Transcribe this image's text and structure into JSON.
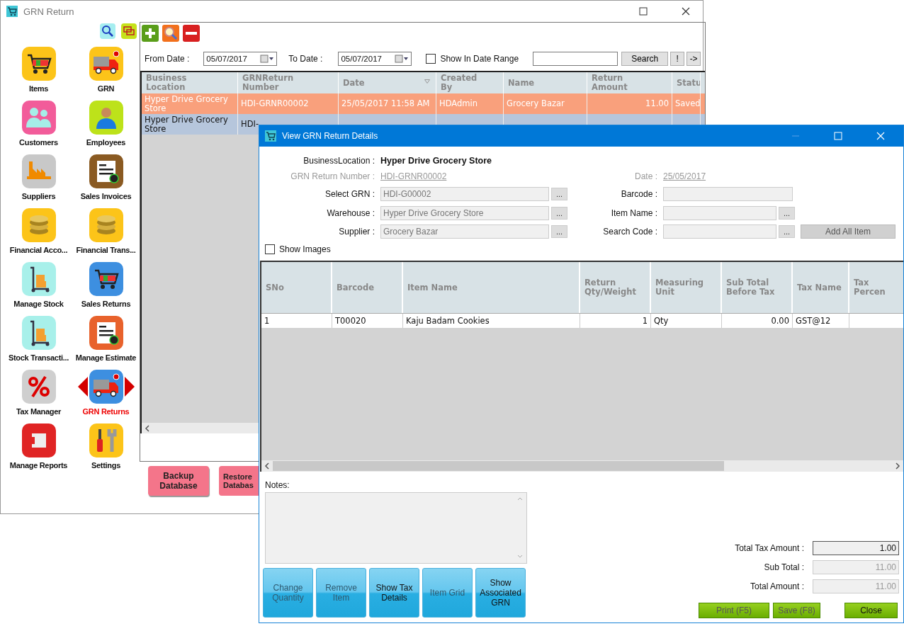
{
  "main_window": {
    "title": "GRN Return"
  },
  "sidebar": {
    "items": [
      {
        "label": "Items",
        "color": "#fcc419",
        "selected": false
      },
      {
        "label": "GRN",
        "color": "#fcc419",
        "selected": false
      },
      {
        "label": "Customers",
        "color": "#f25c9a",
        "selected": false
      },
      {
        "label": "Employees",
        "color": "#bde21a",
        "selected": false
      },
      {
        "label": "Suppliers",
        "color": "#c8c8c8",
        "selected": false
      },
      {
        "label": "Sales Invoices",
        "color": "#8a5a22",
        "selected": false
      },
      {
        "label": "Financial Acco...",
        "color": "#fcc419",
        "selected": false
      },
      {
        "label": "Financial Trans...",
        "color": "#fcc419",
        "selected": false
      },
      {
        "label": "Manage Stock",
        "color": "#a8f0ea",
        "selected": false
      },
      {
        "label": "Sales Returns",
        "color": "#3d8fe0",
        "selected": false
      },
      {
        "label": "Stock Transacti...",
        "color": "#a8f0ea",
        "selected": false
      },
      {
        "label": "Manage Estimate",
        "color": "#e8622c",
        "selected": false
      },
      {
        "label": "Tax Manager",
        "color": "#cfcfcf",
        "selected": false
      },
      {
        "label": "GRN Returns",
        "color": "#3d8fe0",
        "selected": true
      },
      {
        "label": "Manage Reports",
        "color": "#e02424",
        "selected": false
      },
      {
        "label": "Settings",
        "color": "#fcc419",
        "selected": false
      }
    ]
  },
  "filter": {
    "from_label": "From Date :",
    "from_date": "05/07/2017",
    "to_label": "To Date :",
    "to_date": "05/07/2017",
    "date_range": {
      "label": "Show In Date Range",
      "checked": false
    },
    "search_button": "Search",
    "button_2": "!",
    "button_3": "->"
  },
  "grn_table": {
    "columns": [
      {
        "label": "Business Location",
        "sorted": false
      },
      {
        "label": "GRNReturn Number",
        "sorted": false
      },
      {
        "label": "Date",
        "sorted": true
      },
      {
        "label": "Created By",
        "sorted": false
      },
      {
        "label": "Name",
        "sorted": false
      },
      {
        "label": "Return Amount",
        "sorted": false
      },
      {
        "label": "Statu",
        "sorted": false
      }
    ],
    "rows": [
      {
        "selected": true,
        "business_location": "Hyper Drive Grocery Store",
        "grn_return_number": "HDI-GRNR00002",
        "date": "25/05/2017 11:58 AM",
        "created_by": "HDAdmin",
        "name": "Grocery Bazar",
        "return_amount": "11.00",
        "status": "Saved"
      },
      {
        "selected": false,
        "business_location": "Hyper Drive Grocery Store",
        "grn_return_number": "HDI-"
      }
    ]
  },
  "database_buttons": [
    "Backup Database",
    "Restore Databas"
  ],
  "dialog": {
    "title": "View GRN Return Details",
    "business_location": {
      "label": "BusinessLocation :",
      "value": "Hyper Drive Grocery Store"
    },
    "grn_return_number": {
      "label": "GRN Return Number :",
      "value": "HDI-GRNR00002"
    },
    "date": {
      "label": "Date :",
      "value": "25/05/2017"
    },
    "select_grn": {
      "label": "Select GRN :",
      "value": "HDI-G00002",
      "button": "..."
    },
    "barcode": {
      "label": "Barcode :"
    },
    "warehouse": {
      "label": "Warehouse :",
      "value": "Hyper Drive Grocery Store",
      "button": "..."
    },
    "item_name": {
      "label": "Item Name :",
      "button": "..."
    },
    "supplier": {
      "label": "Supplier :",
      "value": "Grocery Bazar",
      "button": "..."
    },
    "search_code": {
      "label": "Search Code :",
      "button": "..."
    },
    "add_all_button": {
      "label": "Add All Item",
      "disabled": true
    },
    "show_images": {
      "label": "Show Images",
      "checked": false
    },
    "items_table": {
      "columns": [
        "SNo",
        "Barcode",
        "Item Name",
        "Return Qty/Weight",
        "Measuring Unit",
        "Sub Total Before Tax",
        "Tax Name",
        "Tax Percen"
      ],
      "rows": [
        {
          "sno": "1",
          "barcode": "T00020",
          "item_name": "Kaju Badam Cookies",
          "return_qty": "1",
          "measuring_unit": "Qty",
          "sub_total": "0.00",
          "tax_name": "GST@12"
        }
      ]
    },
    "notes": {
      "label": "Notes:"
    },
    "action_buttons": [
      {
        "label": "Change Quantity",
        "disabled": true
      },
      {
        "label": "Remove Item",
        "disabled": true
      },
      {
        "label": "Show Tax Details",
        "disabled": false
      },
      {
        "label": "Item Grid",
        "disabled": true
      },
      {
        "label": "Show Associated GRN",
        "disabled": false
      }
    ],
    "totals": [
      {
        "label": "Total Tax Amount :",
        "value": "1.00",
        "disabled": false
      },
      {
        "label": "Sub Total :",
        "value": "11.00",
        "disabled": true
      },
      {
        "label": "Total Amount :",
        "value": "11.00",
        "disabled": true
      }
    ],
    "footer_buttons": [
      {
        "label": "Print (F5)",
        "disabled": true
      },
      {
        "label": "Save (F8)",
        "disabled": true
      },
      {
        "label": "Close",
        "disabled": false
      }
    ]
  }
}
